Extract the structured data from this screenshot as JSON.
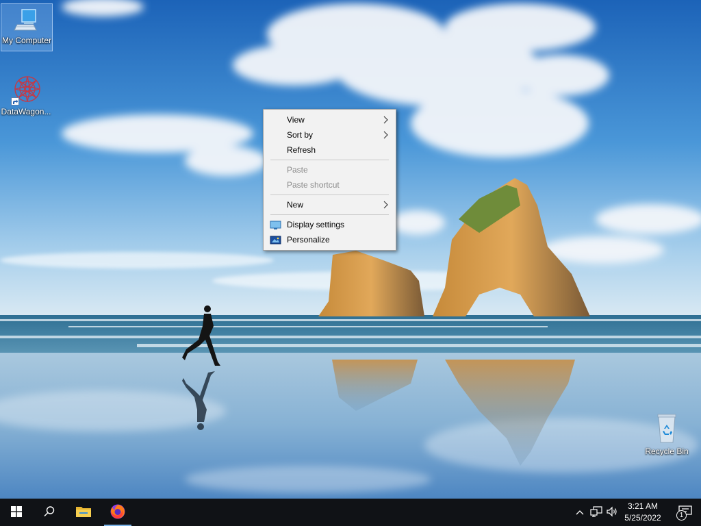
{
  "desktop": {
    "icons": [
      {
        "label": "My Computer",
        "icon": "computer-icon"
      },
      {
        "label": "DataWagon...",
        "icon": "datawagon-icon"
      },
      {
        "label": "Recycle Bin",
        "icon": "recycle-bin-icon"
      }
    ]
  },
  "context_menu": {
    "items": {
      "view": "View",
      "sort_by": "Sort by",
      "refresh": "Refresh",
      "paste": "Paste",
      "paste_shortcut": "Paste shortcut",
      "new": "New",
      "display_settings": "Display settings",
      "personalize": "Personalize"
    }
  },
  "taskbar": {
    "buttons": [
      "windows-start-icon",
      "search-icon",
      "file-explorer-icon",
      "firefox-icon"
    ],
    "tray": [
      "chevron-up-icon",
      "network-icon",
      "volume-icon"
    ],
    "clock": {
      "time": "3:21 AM",
      "date": "5/25/2022"
    },
    "notifications": {
      "icon": "action-center-icon",
      "count": "1"
    }
  },
  "colors": {
    "taskbar_bg": "#101216",
    "menu_bg": "#f2f2f2",
    "running_indicator": "#7bb3e8"
  }
}
